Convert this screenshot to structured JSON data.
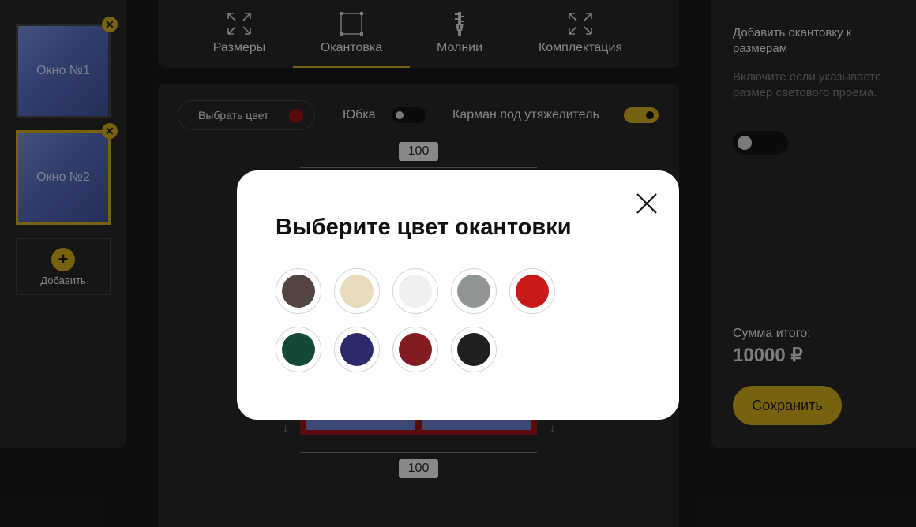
{
  "sidebar": {
    "windows": [
      {
        "label": "Окно №1",
        "active": false
      },
      {
        "label": "Окно №2",
        "active": true
      }
    ],
    "add_label": "Добавить",
    "close_glyph": "✕",
    "add_glyph": "+"
  },
  "tabs": [
    {
      "label": "Размеры",
      "icon": "expand-arrows-icon",
      "active": false
    },
    {
      "label": "Окантовка",
      "icon": "frame-border-icon",
      "active": true
    },
    {
      "label": "Молнии",
      "icon": "zipper-icon",
      "active": false
    },
    {
      "label": "Комплектация",
      "icon": "expand-arrows-icon",
      "active": false
    }
  ],
  "options": {
    "pick_color_label": "Выбрать цвет",
    "selected_color": "#8a1212",
    "skirt_label": "Юбка",
    "skirt_on": false,
    "weight_pocket_label": "Карман под утяжелитель",
    "weight_pocket_on": true
  },
  "dimensions": {
    "top_width": "100",
    "bottom_width": "100"
  },
  "right_panel": {
    "title": "Добавить окантовку к размерам",
    "hint": "Включите если указываете размер светового проема.",
    "toggle_on": false,
    "total_label": "Сумма итого:",
    "total_value": "10000 ₽",
    "save_label": "Сохранить"
  },
  "modal": {
    "title": "Выберите цвет окантовки",
    "colors": [
      {
        "name": "brown",
        "hex": "#54443f"
      },
      {
        "name": "beige",
        "hex": "#e8dbbb"
      },
      {
        "name": "white",
        "hex": "#f0f0f0"
      },
      {
        "name": "gray",
        "hex": "#8f9494"
      },
      {
        "name": "red",
        "hex": "#c8191b"
      },
      {
        "name": "green",
        "hex": "#124a35"
      },
      {
        "name": "navy",
        "hex": "#2c2b6a"
      },
      {
        "name": "burgundy",
        "hex": "#821a22"
      },
      {
        "name": "black",
        "hex": "#1f1f1f"
      }
    ]
  },
  "theme": {
    "accent": "#b89618",
    "panel": "#222222",
    "background": "#151515"
  }
}
